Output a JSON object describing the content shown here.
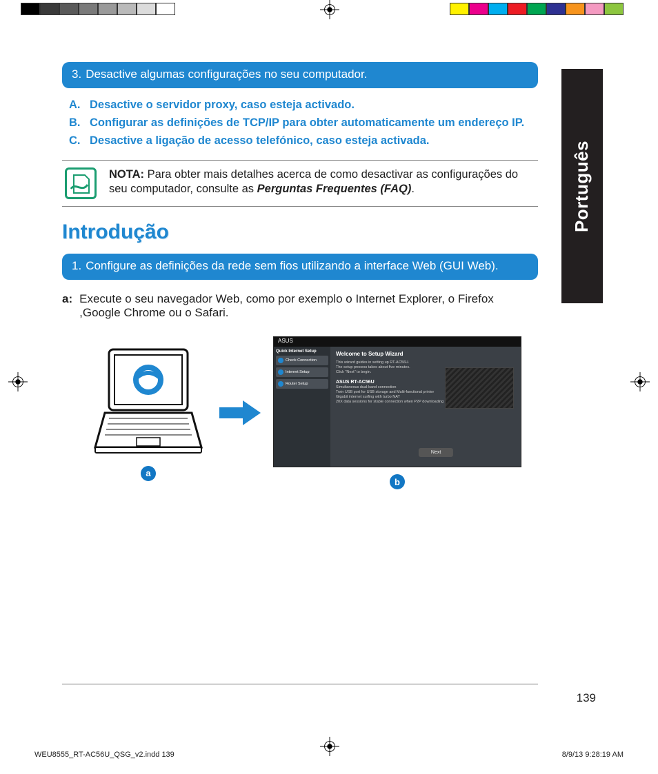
{
  "printer_bars": {
    "grays": [
      "#000",
      "#3a3a3a",
      "#5a5a5a",
      "#7a7a7a",
      "#9a9a9a",
      "#bababa",
      "#dcdcdc",
      "#fff"
    ],
    "colors": [
      "#fff200",
      "#ec008c",
      "#00aeef",
      "#ed1c24",
      "#00a651",
      "#2e3192",
      "#f7941d",
      "#f49ac1",
      "#8dc63f"
    ]
  },
  "language_tab": "Português",
  "step3": {
    "number": "3.",
    "text": "Desactive algumas configurações no seu computador."
  },
  "sub_steps": [
    {
      "letter": "A.",
      "text": "Desactive o servidor proxy, caso esteja activado."
    },
    {
      "letter": "B.",
      "text": "Configurar as definições de TCP/IP para obter automaticamente um endereço IP."
    },
    {
      "letter": "C.",
      "text": "Desactive a ligação de acesso telefónico, caso esteja activada."
    }
  ],
  "note": {
    "label": "NOTA:",
    "body_before": "Para obter mais detalhes acerca de como desactivar as configu­rações do seu computador, consulte as ",
    "faq": "Perguntas Frequentes (FAQ)",
    "body_after": "."
  },
  "section_title": "Introdução",
  "step1": {
    "number": "1.",
    "text": "Configure as definições da rede sem fios utilizando a interface Web (GUI Web)."
  },
  "step_a": {
    "label": "a:",
    "text": "Execute o seu navegador Web, como por exemplo o Internet Explorer, o Firefox ,Google Chrome ou o Safari."
  },
  "badges": {
    "a": "a",
    "b": "b"
  },
  "wizard": {
    "brand": "ASUS",
    "nav_head": "Quick Internet Setup",
    "nav_items": [
      "Check Connection",
      "Internet Setup",
      "Router Setup"
    ],
    "title": "Welcome to Setup Wizard",
    "line1": "This wizard guides in setting up RT-AC56U.",
    "line2": "The setup process takes about five minutes.",
    "line3": "Click \"Next\" to begin.",
    "model_line": "ASUS RT-AC56U",
    "feat1": "Simultaneous dual-band connection",
    "feat2": "Twin USB port for USB storage and Multi-functional printer",
    "feat3": "Gigabit internet surfing with turbo NAT",
    "feat4": "20X data sessions for stable connection when P2P downloading",
    "next": "Next"
  },
  "page_number": "139",
  "slug": {
    "file": "WEU8555_RT-AC56U_QSG_v2.indd   139",
    "date": "8/9/13   9:28:19 AM"
  }
}
